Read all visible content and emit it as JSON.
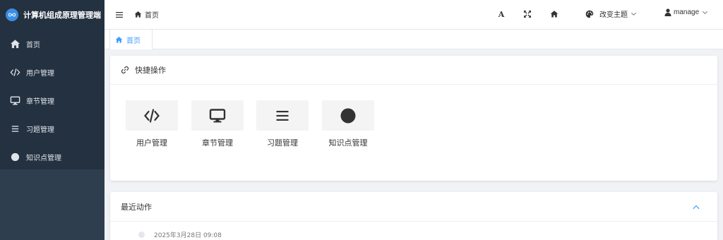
{
  "app": {
    "title": "计算机组成原理管理端"
  },
  "sidebar": {
    "items": [
      {
        "label": "首页",
        "icon": "home-icon"
      },
      {
        "label": "用户管理",
        "icon": "code-icon"
      },
      {
        "label": "章节管理",
        "icon": "monitor-icon"
      },
      {
        "label": "习题管理",
        "icon": "list-icon"
      },
      {
        "label": "知识点管理",
        "icon": "circle-icon"
      }
    ]
  },
  "header": {
    "breadcrumb": "首页",
    "font_icon_label": "A",
    "theme_label": "改变主题",
    "user_label": "manage"
  },
  "tabs": [
    {
      "label": "首页",
      "active": true
    }
  ],
  "quick_card": {
    "title": "快捷操作",
    "items": [
      {
        "label": "用户管理",
        "icon": "code-icon"
      },
      {
        "label": "章节管理",
        "icon": "monitor-icon"
      },
      {
        "label": "习题管理",
        "icon": "list-icon"
      },
      {
        "label": "知识点管理",
        "icon": "circle-icon"
      }
    ]
  },
  "recent_card": {
    "title": "最近动作",
    "entries": [
      {
        "time": "2025年3月28日 09:08"
      }
    ]
  },
  "colors": {
    "sidebar_bg": "#243140",
    "sidebar_lower_bg": "#2f3e4f",
    "accent": "#409eff",
    "logo_bg": "#3a8ee6"
  }
}
